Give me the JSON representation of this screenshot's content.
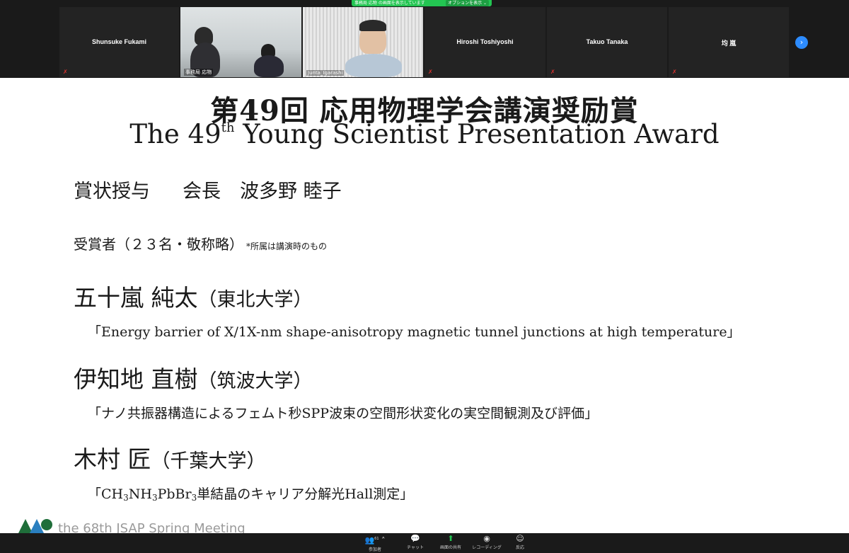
{
  "share_banner": {
    "text": "事務局 応物 の画面を表示しています",
    "options": "オプションを表示 ⌄"
  },
  "participants": [
    {
      "name": "Shunsuke Fukami"
    },
    {
      "name": "事務局 応物"
    },
    {
      "name": "Junta_Igarashi"
    },
    {
      "name": "Hiroshi Toshiyoshi"
    },
    {
      "name": "Takuo Tanaka"
    },
    {
      "name": "均 嵐"
    }
  ],
  "reaction_icon": "clapping-hands",
  "next_page_icon": "chevron-right",
  "slide": {
    "title_jp": "第49回 応用物理学会講演奨励賞",
    "title_en_pre": "The 49",
    "title_en_sup": "th",
    "title_en_post": " Young Scientist Presentation Award",
    "award_presenter_label": "賞状授与",
    "award_presenter_name": "会長　波多野 睦子",
    "recipients_label": "受賞者（２３名・敬称略）",
    "recipients_note": "*所属は講演時のもの",
    "winners": [
      {
        "name": "五十嵐 純太",
        "affiliation": "（東北大学）",
        "talk": "「Energy barrier of X/1X-nm shape-anisotropy magnetic tunnel junctions at high temperature」"
      },
      {
        "name": "伊知地 直樹",
        "affiliation": "（筑波大学）",
        "talk": "「ナノ共振器構造によるフェムト秒SPP波束の空間形状変化の実空間観測及び評価」"
      },
      {
        "name": "木村 匠",
        "affiliation": "（千葉大学）",
        "talk_parts": [
          "「CH",
          "3",
          "NH",
          "3",
          "PbBr",
          "3",
          "単結晶のキャリア分解光Hall測定」"
        ]
      }
    ],
    "footer": "the 68th JSAP Spring Meeting"
  },
  "toolbar": {
    "participants_label": "参加者",
    "participants_count": "61",
    "chat_label": "チャット",
    "share_label": "画面の共有",
    "record_label": "レコーディング",
    "reaction_label": "反応"
  },
  "colors": {
    "share_green": "#23c552",
    "accent_blue": "#2d8cff",
    "muted_red": "#e0332f"
  }
}
